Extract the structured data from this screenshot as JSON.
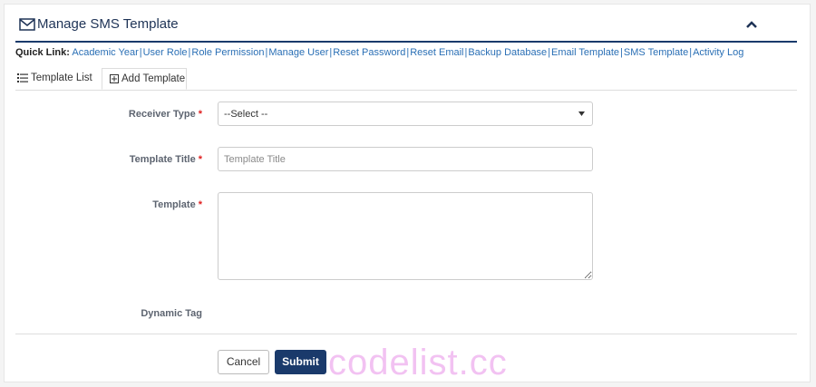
{
  "header": {
    "title": "Manage SMS Template"
  },
  "quick_links": {
    "label": "Quick Link:",
    "items": [
      "Academic Year",
      "User Role",
      "Role Permission",
      "Manage User",
      "Reset Password",
      "Reset Email",
      "Backup Database",
      "Email Template",
      "SMS Template",
      "Activity Log"
    ]
  },
  "tabs": [
    {
      "label": "Template List"
    },
    {
      "label": "Add Template"
    }
  ],
  "form": {
    "receiver_type": {
      "label": "Receiver Type",
      "selected": "--Select --"
    },
    "template_title": {
      "label": "Template Title",
      "placeholder": "Template Title",
      "value": ""
    },
    "template": {
      "label": "Template",
      "value": ""
    },
    "dynamic_tag": {
      "label": "Dynamic Tag"
    },
    "required_mark": "*"
  },
  "buttons": {
    "cancel": "Cancel",
    "submit": "Submit"
  },
  "watermark": "codelist.cc",
  "colors": {
    "primary": "#1a3a6b",
    "link": "#2a6fb5",
    "required": "#e02020",
    "watermark": "#f0b8f0"
  },
  "icons": [
    "mail-icon",
    "chevron-up-icon",
    "list-icon",
    "plus-square-icon",
    "dropdown-caret-icon"
  ]
}
